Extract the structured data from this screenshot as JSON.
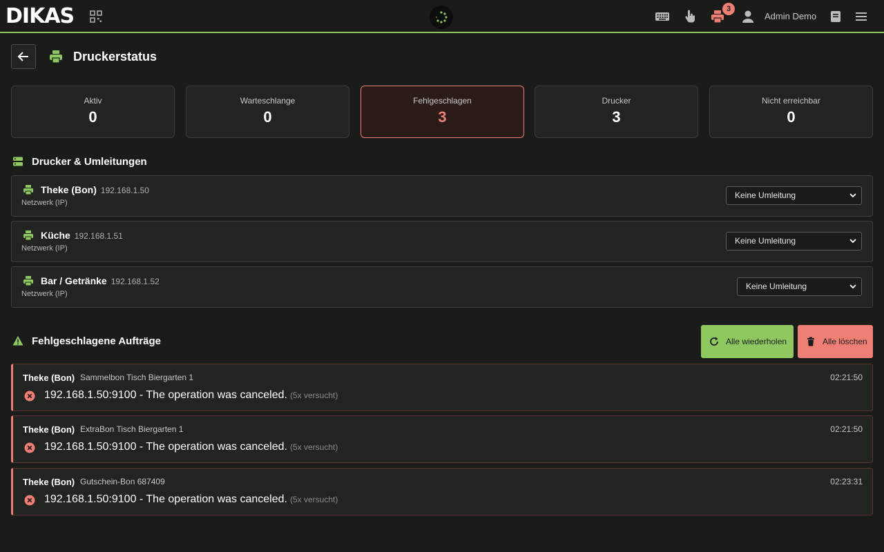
{
  "app": {
    "logo": "DIKAS",
    "username": "Admin Demo",
    "printer_badge": "3"
  },
  "header": {
    "title": "Druckerstatus"
  },
  "stats": [
    {
      "label": "Aktiv",
      "value": "0"
    },
    {
      "label": "Warteschlange",
      "value": "0"
    },
    {
      "label": "Fehlgeschlagen",
      "value": "3"
    },
    {
      "label": "Drucker",
      "value": "3"
    },
    {
      "label": "Nicht erreichbar",
      "value": "0"
    }
  ],
  "printers_section": {
    "title": "Drucker & Umleitungen",
    "items": [
      {
        "name": "Theke (Bon)",
        "ip": "192.168.1.50",
        "type": "Netzwerk (IP)",
        "redirect": "Keine Umleitung"
      },
      {
        "name": "Küche",
        "ip": "192.168.1.51",
        "type": "Netzwerk (IP)",
        "redirect": "Keine Umleitung"
      },
      {
        "name": "Bar / Getränke",
        "ip": "192.168.1.52",
        "type": "Netzwerk (IP)",
        "redirect": "Keine Umleitung"
      }
    ]
  },
  "failed_section": {
    "title": "Fehlgeschlagene Aufträge",
    "retry_all": "Alle wiederholen",
    "delete_all": "Alle löschen",
    "jobs": [
      {
        "printer": "Theke (Bon)",
        "document": "Sammelbon Tisch Biergarten 1",
        "time": "02:21:50",
        "message": "192.168.1.50:9100 - The operation was canceled.",
        "tries": "(5x versucht)"
      },
      {
        "printer": "Theke (Bon)",
        "document": "ExtraBon Tisch Biergarten 1",
        "time": "02:21:50",
        "message": "192.168.1.50:9100 - The operation was canceled.",
        "tries": "(5x versucht)"
      },
      {
        "printer": "Theke (Bon)",
        "document": "Gutschein-Bon 687409",
        "time": "02:23:31",
        "message": "192.168.1.50:9100 - The operation was canceled.",
        "tries": "(5x versucht)"
      }
    ]
  },
  "colors": {
    "accent_green": "#8fc860",
    "error_red": "#ef7f75",
    "background": "#1a1c1a"
  }
}
